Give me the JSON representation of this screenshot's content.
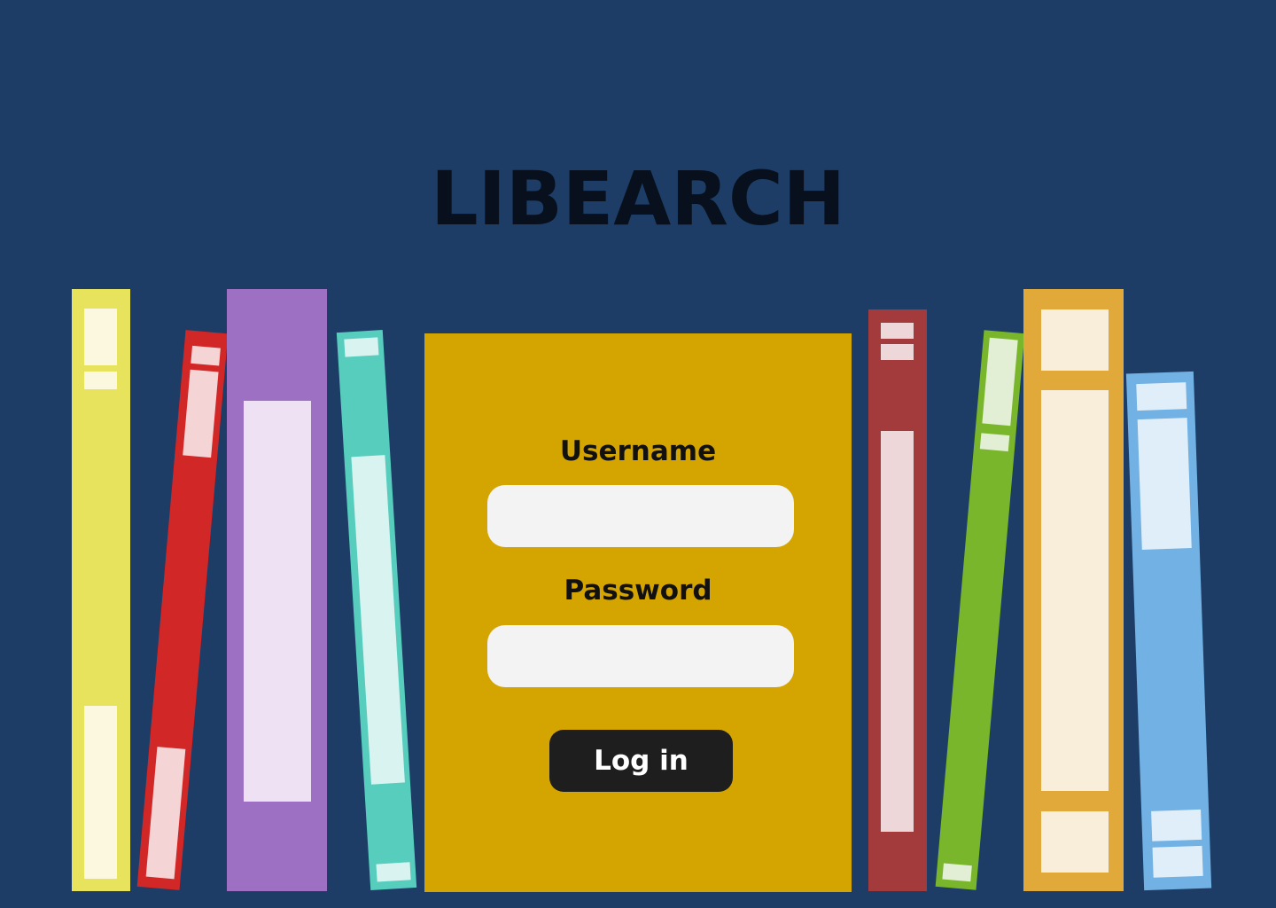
{
  "app": {
    "title": "LIBEARCH"
  },
  "login_form": {
    "username_label": "Username",
    "username_value": "",
    "password_label": "Password",
    "password_value": "",
    "submit_label": "Log in"
  },
  "colors": {
    "background": "#1d3d66",
    "title": "#07101c",
    "panel": "#d4a400",
    "input": "#f3f3f3",
    "button": "#1e1e1e",
    "button_text": "#ffffff",
    "books": {
      "yellow": "#e8e35c",
      "red": "#d12727",
      "purple": "#9e70c4",
      "teal": "#57cdbe",
      "dark_red": "#a33b3d",
      "green": "#79b62c",
      "orange": "#e1a83a",
      "blue": "#71b1e3"
    }
  }
}
